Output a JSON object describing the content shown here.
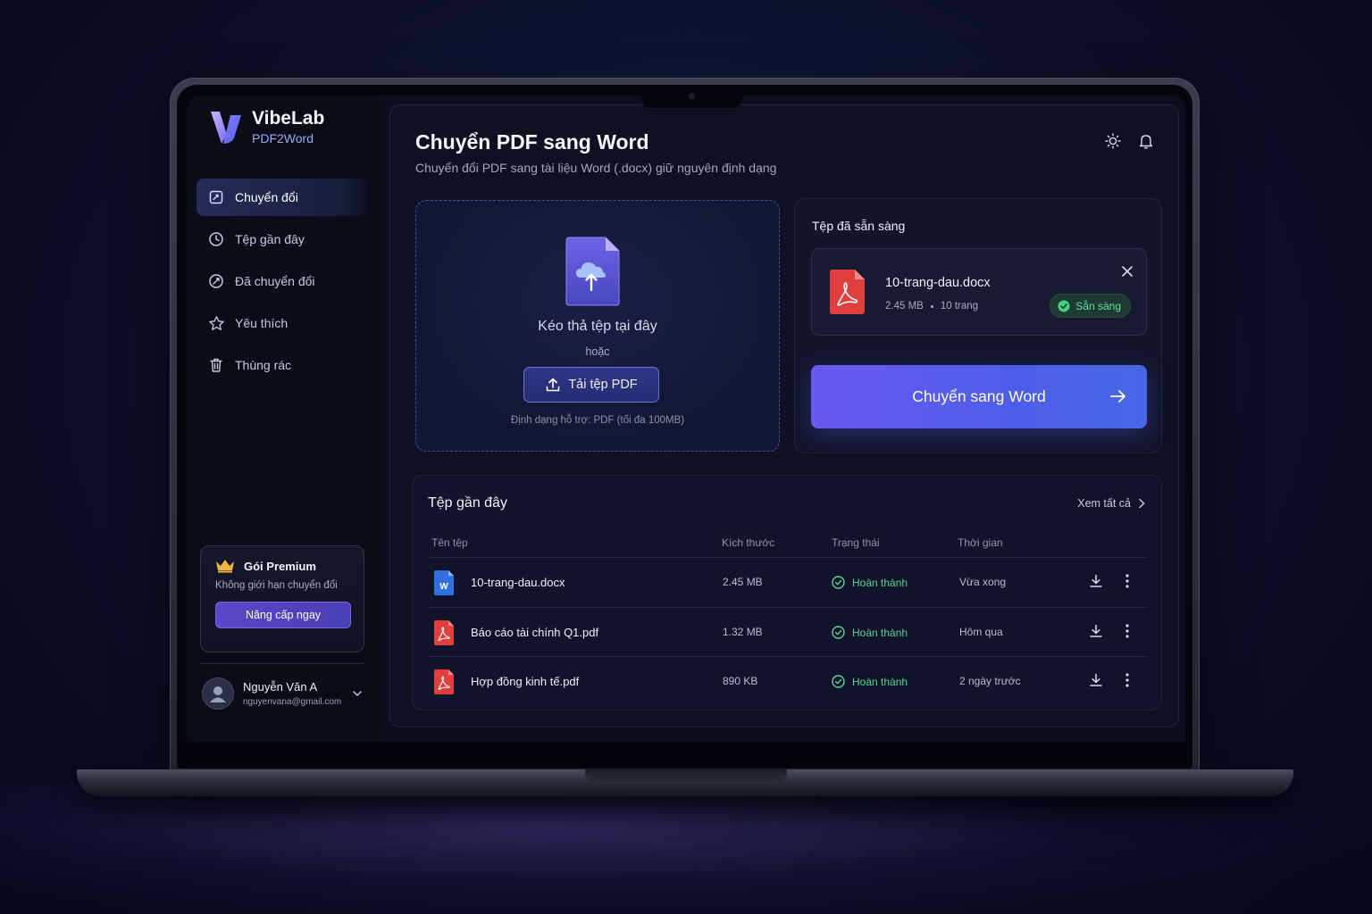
{
  "app": {
    "brand_name": "VibeLab",
    "brand_sub": "PDF2Word"
  },
  "sidebar": {
    "items": [
      {
        "label": "Chuyển đổi",
        "icon": "convert-icon",
        "active": true
      },
      {
        "label": "Tệp gần đây",
        "icon": "clock-icon",
        "active": false
      },
      {
        "label": "Đã chuyển đổi",
        "icon": "converted-icon",
        "active": false
      },
      {
        "label": "Yêu thích",
        "icon": "star-icon",
        "active": false
      },
      {
        "label": "Thùng rác",
        "icon": "trash-icon",
        "active": false
      }
    ],
    "premium": {
      "title": "Gói Premium",
      "desc": "Không giới hạn chuyển đổi",
      "button": "Nâng cấp ngay"
    },
    "user": {
      "name": "Nguyễn Văn A",
      "email": "nguyenvana@gmail.com"
    }
  },
  "header": {
    "title": "Chuyển PDF sang Word",
    "subtitle": "Chuyển đổi PDF sang tài liệu Word (.docx) giữ nguyên định dạng",
    "icons": [
      "sun-icon",
      "bell-icon"
    ]
  },
  "upload": {
    "drop_text": "Kéo thả tệp tại đây",
    "or_text": "hoặc",
    "button": "Tải tệp PDF",
    "note": "Định dạng hỗ trợ: PDF (tối đa 100MB)"
  },
  "ready": {
    "title": "Tệp đã sẵn sàng",
    "file_name": "10-trang-dau.docx",
    "file_size": "2.45 MB",
    "pages": "10 trang",
    "status": "Sẵn sàng",
    "convert_button": "Chuyển sang Word"
  },
  "recent": {
    "title": "Tệp gần đây",
    "see_all": "Xem tất cả",
    "columns": [
      "Tên tệp",
      "Kích thước",
      "Trạng thái",
      "Thời gian"
    ],
    "rows": [
      {
        "name": "10-trang-dau.docx",
        "type": "word",
        "size": "2.45 MB",
        "status": "Hoàn thành",
        "time": "Vừa xong"
      },
      {
        "name": "Báo cáo tài chính Q1.pdf",
        "type": "pdf",
        "size": "1.32 MB",
        "status": "Hoàn thành",
        "time": "Hôm qua"
      },
      {
        "name": "Hợp đồng kinh tế.pdf",
        "type": "pdf",
        "size": "890 KB",
        "status": "Hoàn thành",
        "time": "2 ngày trước"
      }
    ]
  },
  "colors": {
    "accent": "#6a58f0",
    "success": "#57d68f",
    "pdf_red": "#e0403d",
    "word_blue": "#2f6fe0"
  }
}
